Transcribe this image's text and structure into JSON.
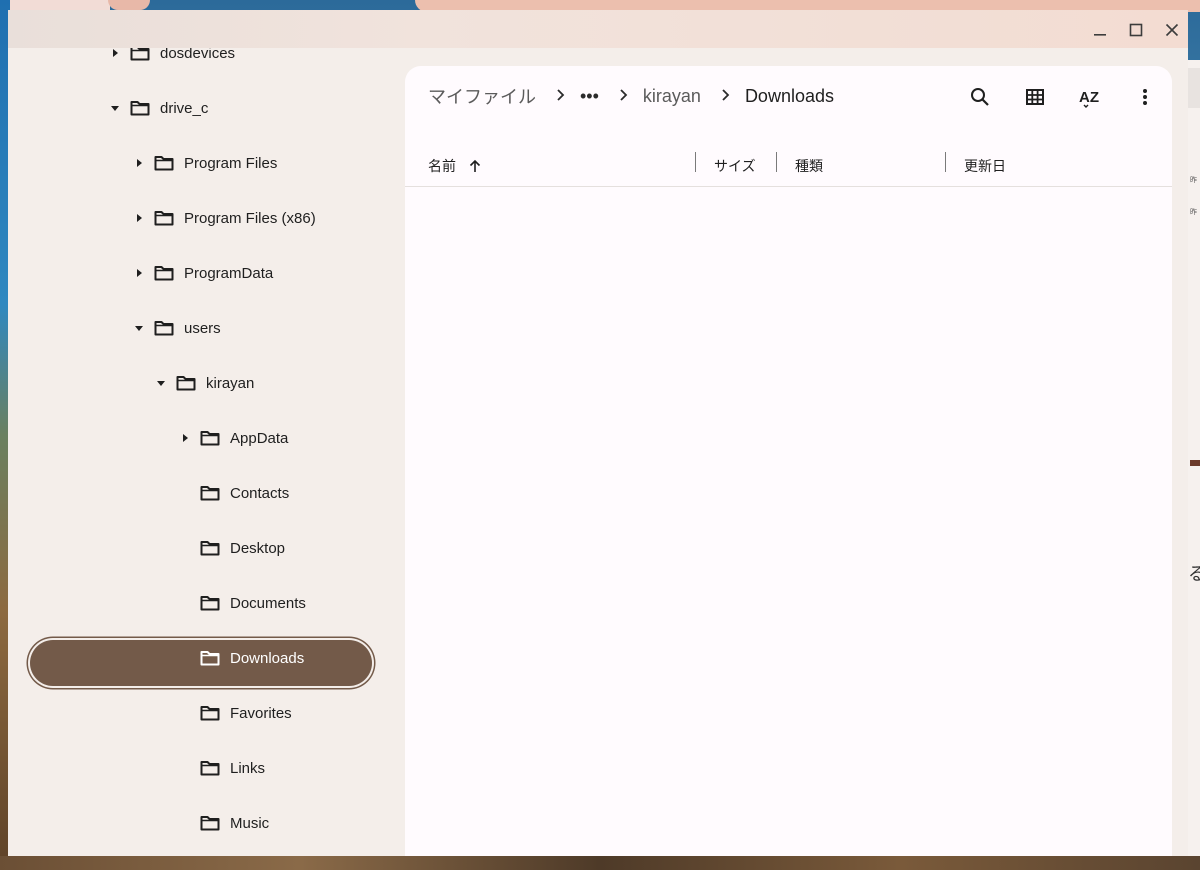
{
  "window": {
    "minimize_icon": "minimize-icon",
    "maximize_icon": "maximize-icon",
    "close_icon": "close-icon"
  },
  "sidebar": {
    "items": [
      {
        "label": "dosdevices",
        "caret": "right",
        "selected": false
      },
      {
        "label": "drive_c",
        "caret": "down",
        "selected": false
      },
      {
        "label": "Program Files",
        "caret": "right",
        "selected": false
      },
      {
        "label": "Program Files (x86)",
        "caret": "right",
        "selected": false
      },
      {
        "label": "ProgramData",
        "caret": "right",
        "selected": false
      },
      {
        "label": "users",
        "caret": "down",
        "selected": false
      },
      {
        "label": "kirayan",
        "caret": "down",
        "selected": false
      },
      {
        "label": "AppData",
        "caret": "right",
        "selected": false
      },
      {
        "label": "Contacts",
        "caret": "none",
        "selected": false
      },
      {
        "label": "Desktop",
        "caret": "none",
        "selected": false
      },
      {
        "label": "Documents",
        "caret": "none",
        "selected": false
      },
      {
        "label": "Downloads",
        "caret": "none",
        "selected": true
      },
      {
        "label": "Favorites",
        "caret": "none",
        "selected": false
      },
      {
        "label": "Links",
        "caret": "none",
        "selected": false
      },
      {
        "label": "Music",
        "caret": "none",
        "selected": false
      }
    ]
  },
  "breadcrumb": {
    "root": "マイファイル",
    "ellipsis": "•••",
    "parent": "kirayan",
    "current": "Downloads",
    "separator": ">"
  },
  "toolbar": {
    "search_icon": "search-icon",
    "grid_view_icon": "grid-view-icon",
    "sort_icon": "sort-az-icon",
    "sort_label": "AZ",
    "more_icon": "more-vert-icon"
  },
  "columns": {
    "name": "名前",
    "size": "サイズ",
    "type": "種類",
    "modified": "更新日",
    "sort_direction": "ascending"
  },
  "files": [],
  "background_window": {
    "glyph": "る"
  },
  "colors": {
    "selected_bg": "#735a49",
    "sidebar_bg": "#f4eeea",
    "content_bg": "#fffbfe",
    "titlebar_accent": "#ecbfae"
  }
}
